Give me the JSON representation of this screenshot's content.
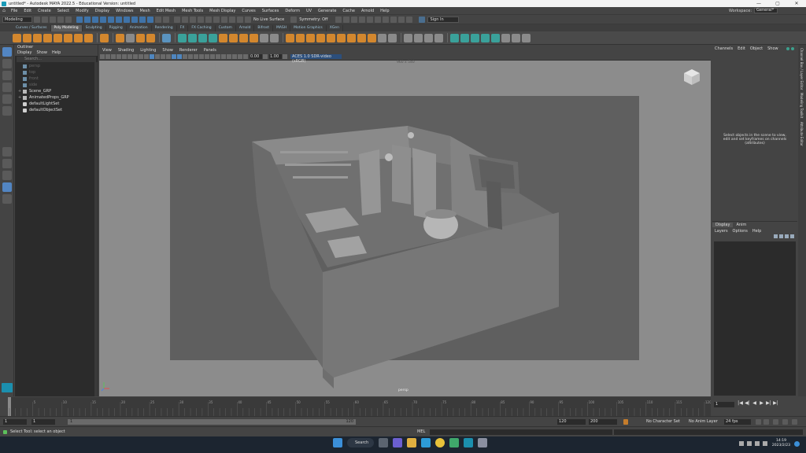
{
  "window": {
    "title": "untitled* - Autodesk MAYA 2022.5 - Educational Version: untitled",
    "controls": [
      "—",
      "▢",
      "✕"
    ]
  },
  "menubar": {
    "items": [
      "File",
      "Edit",
      "Create",
      "Select",
      "Modify",
      "Display",
      "Windows",
      "Mesh",
      "Edit Mesh",
      "Mesh Tools",
      "Mesh Display",
      "Curves",
      "Surfaces",
      "Deform",
      "UV",
      "Generate",
      "Cache",
      "Arnold",
      "Help"
    ],
    "workspace_label": "Workspace:",
    "workspace_value": "General*"
  },
  "statusline": {
    "mode": "Modeling",
    "live_surface": "No Live Surface",
    "symmetry": "Symmetry: Off",
    "sign_in": "Sign In"
  },
  "shelf": {
    "tabs": [
      "Curves / Surfaces",
      "Poly Modeling",
      "Sculpting",
      "Rigging",
      "Animation",
      "Rendering",
      "FX",
      "FX Caching",
      "Custom",
      "Arnold",
      "Bifrost",
      "MASH",
      "Motion Graphics",
      "XGen"
    ],
    "active_tab": "Poly Modeling"
  },
  "outliner": {
    "title": "Outliner",
    "menu": [
      "Display",
      "Show",
      "Help"
    ],
    "search_placeholder": "Search...",
    "items": [
      {
        "label": "persp",
        "dim": true
      },
      {
        "label": "top",
        "dim": true
      },
      {
        "label": "front",
        "dim": true
      },
      {
        "label": "side",
        "dim": true
      },
      {
        "label": "Scene_GRP",
        "dim": false
      },
      {
        "label": "AnimatedProps_GRP",
        "dim": false
      },
      {
        "label": "defaultLightSet",
        "dim": false
      },
      {
        "label": "defaultObjectSet",
        "dim": false
      }
    ]
  },
  "viewport": {
    "menu": [
      "View",
      "Shading",
      "Lighting",
      "Show",
      "Renderer",
      "Panels"
    ],
    "field_a": "0.00",
    "field_b": "1.00",
    "color_space": "ACES 1.0 SDR-video (sRGB)",
    "resolution": "960 x 540",
    "camera": "persp"
  },
  "channelbox": {
    "menu": [
      "Channels",
      "Edit",
      "Object",
      "Show"
    ],
    "message": "Select objects in the scene to view, edit and set keyframes on channels (attributes)"
  },
  "layers": {
    "tabs": [
      "Display",
      "Anim"
    ],
    "menu": [
      "Layers",
      "Options",
      "Help"
    ]
  },
  "side_tabs": [
    "Channel Box / Layer Editor",
    "Modeling Toolkit",
    "Attribute Editor"
  ],
  "timeline": {
    "ticks": [
      "5",
      "10",
      "15",
      "20",
      "25",
      "30",
      "35",
      "40",
      "45",
      "50",
      "55",
      "60",
      "65",
      "70",
      "75",
      "80",
      "85",
      "90",
      "95",
      "100",
      "105",
      "110",
      "115",
      "120"
    ],
    "current_frame": "1",
    "playback": [
      "|◀",
      "◀|",
      "◀",
      "▶",
      "▶|",
      "▶|"
    ]
  },
  "range": {
    "start": "1",
    "inner_start": "1",
    "inner_end": "120",
    "end_a": "120",
    "end_b": "200",
    "character_set": "No Character Set",
    "anim_layer": "No Anim Layer",
    "fps": "24 fps"
  },
  "commandline": {
    "help_text": "Select Tool: select an object",
    "mel_label": "MEL"
  },
  "taskbar": {
    "search": "Search",
    "time": "14:19",
    "date": "2023/2/23"
  }
}
